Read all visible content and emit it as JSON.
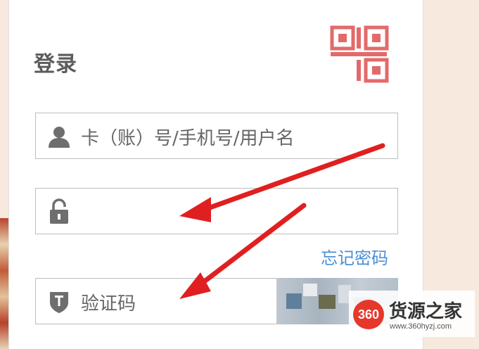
{
  "login": {
    "title": "登录",
    "username_placeholder": "卡（账）号/手机号/用户名",
    "password_placeholder": "",
    "forgot_password": "忘记密码",
    "captcha_placeholder": "验证码"
  },
  "watermark": {
    "logo_text": "360",
    "brand": "货源之家",
    "url": "www.360hyzj.com"
  },
  "colors": {
    "qr_accent": "#e36a6a",
    "link": "#4a8fd6",
    "arrow": "#e02020",
    "background": "#f8e9df"
  },
  "icons": {
    "qr": "qr-code-icon",
    "user": "user-icon",
    "lock": "lock-icon",
    "shield": "shield-icon"
  }
}
